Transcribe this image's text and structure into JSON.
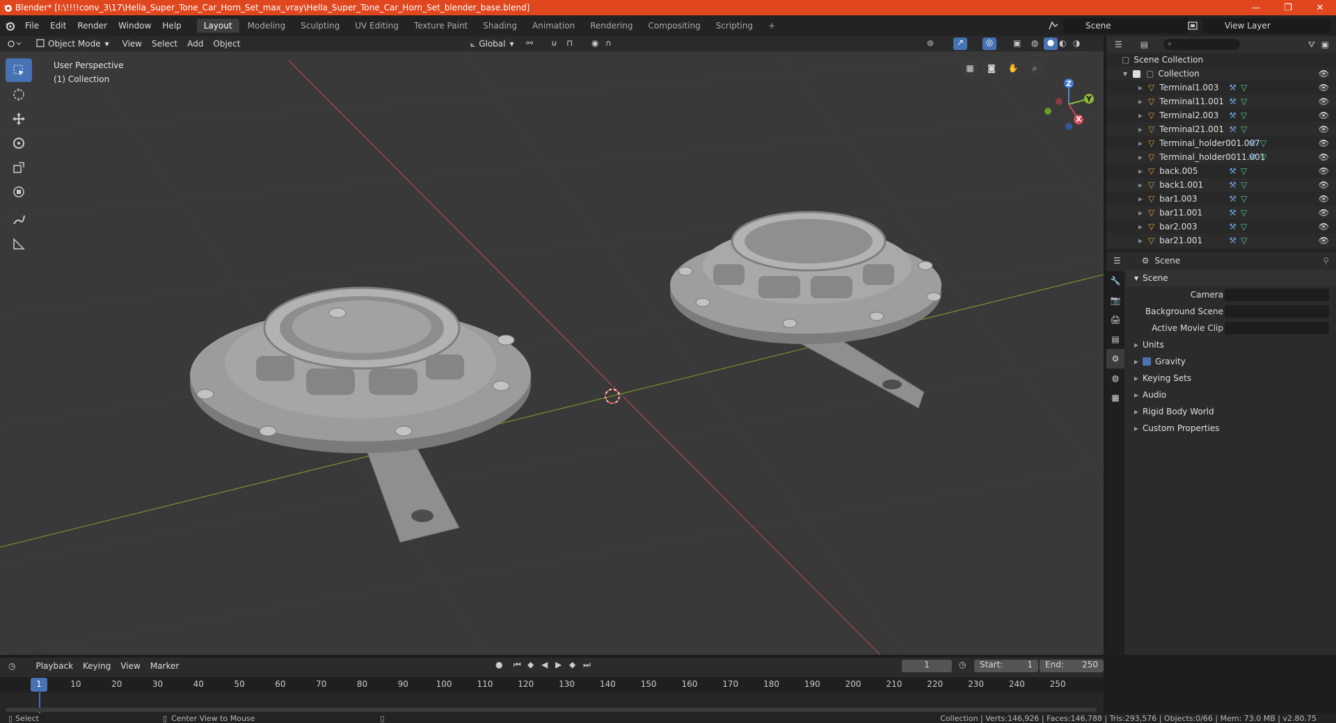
{
  "window": {
    "title": "Blender* [I:\\!!!!conv_3\\17\\Hella_Super_Tone_Car_Horn_Set_max_vray\\Hella_Super_Tone_Car_Horn_Set_blender_base.blend]",
    "minimize": "—",
    "maximize": "❐",
    "close": "✕"
  },
  "menu": {
    "file": "File",
    "edit": "Edit",
    "render": "Render",
    "window": "Window",
    "help": "Help"
  },
  "workspaces": [
    "Layout",
    "Modeling",
    "Sculpting",
    "UV Editing",
    "Texture Paint",
    "Shading",
    "Animation",
    "Rendering",
    "Compositing",
    "Scripting"
  ],
  "workspace_add": "+",
  "scene_name": "Scene",
  "view_layer": "View Layer",
  "viewport": {
    "mode": "Object Mode",
    "menus": {
      "view": "View",
      "select": "Select",
      "add": "Add",
      "object": "Object"
    },
    "orientation": "Global",
    "info_line1": "User Perspective",
    "info_line2": "(1) Collection",
    "gizmo": {
      "x": "X",
      "y": "Y",
      "z": "Z"
    }
  },
  "outliner": {
    "root": "Scene Collection",
    "collection": "Collection",
    "items": [
      "Terminal1.003",
      "Terminal11.001",
      "Terminal2.003",
      "Terminal21.001",
      "Terminal_holder001.007",
      "Terminal_holder0011.001",
      "back.005",
      "back1.001",
      "bar1.003",
      "bar11.001",
      "bar2.003",
      "bar21.001"
    ]
  },
  "properties": {
    "header": "Scene",
    "panel": "Scene",
    "fields": {
      "camera": "Camera",
      "background_scene": "Background Scene",
      "active_movie_clip": "Active Movie Clip"
    },
    "sections": {
      "units": "Units",
      "gravity": "Gravity",
      "keying_sets": "Keying Sets",
      "audio": "Audio",
      "rigid_body": "Rigid Body World",
      "custom": "Custom Properties"
    }
  },
  "timeline": {
    "menus": {
      "playback": "Playback",
      "keying": "Keying",
      "view": "View",
      "marker": "Marker"
    },
    "current_frame": "1",
    "start_label": "Start:",
    "start": "1",
    "end_label": "End:",
    "end": "250",
    "ruler": [
      "1",
      "10",
      "20",
      "30",
      "40",
      "50",
      "60",
      "70",
      "80",
      "90",
      "100",
      "110",
      "120",
      "130",
      "140",
      "150",
      "160",
      "170",
      "180",
      "190",
      "200",
      "210",
      "220",
      "230",
      "240",
      "250"
    ]
  },
  "status": {
    "select": "Select",
    "center_view": "Center View to Mouse",
    "stats": "Collection | Verts:146,926 | Faces:146,788 | Tris:293,576 | Objects:0/66 | Mem: 73.0 MB | v2.80.75"
  },
  "colors": {
    "accent": "#4772b3",
    "titlebar": "#e0471f",
    "x_axis": "#b04545",
    "y_axis": "#7da13a"
  }
}
